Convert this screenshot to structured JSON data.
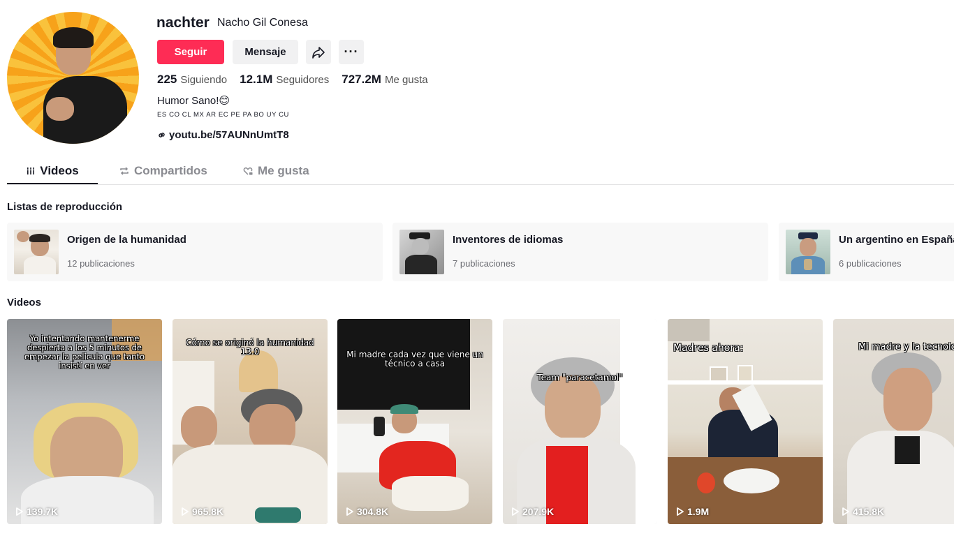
{
  "profile": {
    "username": "nachter",
    "nickname": "Nacho Gil Conesa",
    "follow_label": "Seguir",
    "message_label": "Mensaje",
    "more_label": "···",
    "stats": {
      "following_count": "225",
      "following_label": "Siguiendo",
      "followers_count": "12.1M",
      "followers_label": "Seguidores",
      "likes_count": "727.2M",
      "likes_label": "Me gusta"
    },
    "bio": "Humor Sano!😊",
    "bio_flags": "ES CO CL MX AR EC PE PA BO UY CU",
    "link": "youtu.be/57AUNnUmtT8"
  },
  "tabs": {
    "videos": "Videos",
    "shared": "Compartidos",
    "liked": "Me gusta"
  },
  "playlists_title": "Listas de reproducción",
  "playlists": [
    {
      "title": "Origen de la humanidad",
      "count": "12 publicaciones"
    },
    {
      "title": "Inventores de idiomas",
      "count": "7 publicaciones"
    },
    {
      "title": "Un argentino en España",
      "count": "6 publicaciones"
    }
  ],
  "videos_title": "Videos",
  "videos": [
    {
      "caption": "Yo intentando mantenerme despierta a los 5 minutos de empezar la pelicula que tanto insistí en ver",
      "views": "139.7K"
    },
    {
      "caption": "Cómo se originó la humanidad 13.0",
      "views": "965.8K"
    },
    {
      "caption": "Mi madre cada vez que viene un técnico a casa",
      "views": "304.8K"
    },
    {
      "caption": "Team \"paracetamol\"",
      "views": "207.9K"
    },
    {
      "caption": "Madres ahora:",
      "views": "1.9M"
    },
    {
      "caption": "Mi madre y la tecnología",
      "views": "415.8K"
    }
  ],
  "colors": {
    "accent": "#fe2c55",
    "button_bg": "#f1f1f2",
    "playlist_bg": "#f8f8f8"
  },
  "icons": {
    "share": "share-arrow-icon",
    "link": "link-icon",
    "videos_tab": "grid-lines-icon",
    "shared_tab": "repost-icon",
    "liked_tab": "heart-lock-icon",
    "play": "play-outline-icon"
  }
}
